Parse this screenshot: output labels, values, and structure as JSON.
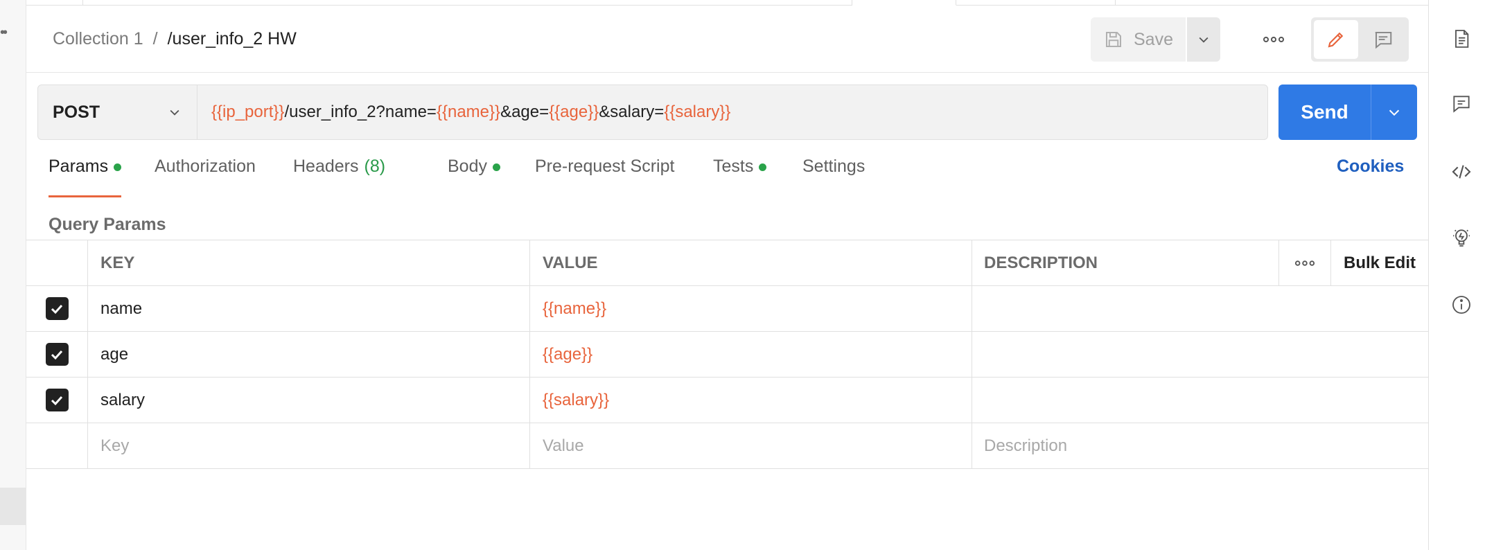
{
  "header": {
    "collection": "Collection 1",
    "separator": "/",
    "request_name": "/user_info_2 HW",
    "save_label": "Save"
  },
  "request": {
    "method": "POST",
    "url_parts": [
      {
        "text": "{{ip_port}}",
        "var": true
      },
      {
        "text": "/user_info_2?name=",
        "var": false
      },
      {
        "text": "{{name}}",
        "var": true
      },
      {
        "text": "&age=",
        "var": false
      },
      {
        "text": "{{age}}",
        "var": true
      },
      {
        "text": "&salary=",
        "var": false
      },
      {
        "text": "{{salary}}",
        "var": true
      }
    ],
    "send_label": "Send"
  },
  "tabs": {
    "params": "Params",
    "authorization": "Authorization",
    "headers": "Headers",
    "headers_count": "(8)",
    "body": "Body",
    "prerequest": "Pre-request Script",
    "tests": "Tests",
    "settings": "Settings",
    "cookies": "Cookies"
  },
  "query_params": {
    "label": "Query Params",
    "columns": {
      "key": "KEY",
      "value": "VALUE",
      "description": "DESCRIPTION",
      "bulk_edit": "Bulk Edit"
    },
    "rows": [
      {
        "key": "name",
        "value": "{{name}}",
        "checked": true
      },
      {
        "key": "age",
        "value": "{{age}}",
        "checked": true
      },
      {
        "key": "salary",
        "value": "{{salary}}",
        "checked": true
      }
    ],
    "placeholders": {
      "key": "Key",
      "value": "Value",
      "description": "Description"
    }
  },
  "colors": {
    "accent": "#e8643c",
    "send": "#2f7ae5",
    "status_dot": "#2aa34a",
    "link": "#1f5fbf"
  },
  "icons": [
    "documentation-icon",
    "comments-icon",
    "code-icon",
    "lightbulb-icon",
    "info-icon",
    "save-icon",
    "pencil-icon",
    "chat-icon",
    "more-icon",
    "chevron-down-icon",
    "checkmark-icon"
  ]
}
